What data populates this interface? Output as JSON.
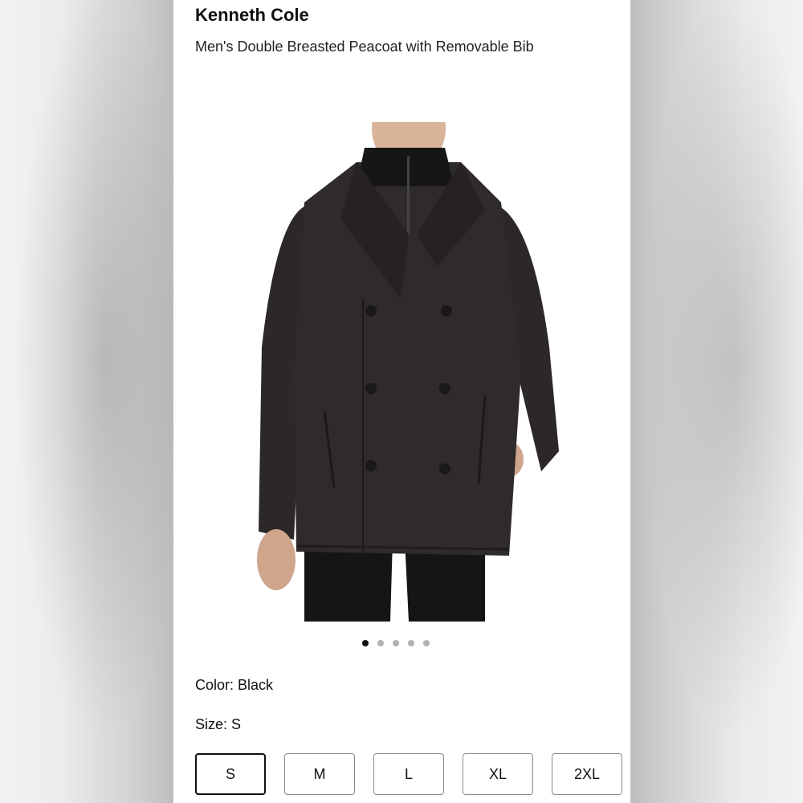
{
  "product": {
    "brand": "Kenneth Cole",
    "title": "Men's Double Breasted Peacoat with Removable Bib"
  },
  "gallery": {
    "image_description": "black double-breasted peacoat",
    "slide_count": 5,
    "active_slide": 1
  },
  "color": {
    "label": "Color:",
    "value": "Black"
  },
  "size": {
    "label": "Size:",
    "value": "S",
    "options": [
      "S",
      "M",
      "L",
      "XL",
      "2XL"
    ],
    "selected_index": 0
  },
  "colors": {
    "coat": "#2e2b2a",
    "selected_border": "#111111",
    "dot_active": "#111111",
    "dot_inactive": "#b3b3b3"
  }
}
